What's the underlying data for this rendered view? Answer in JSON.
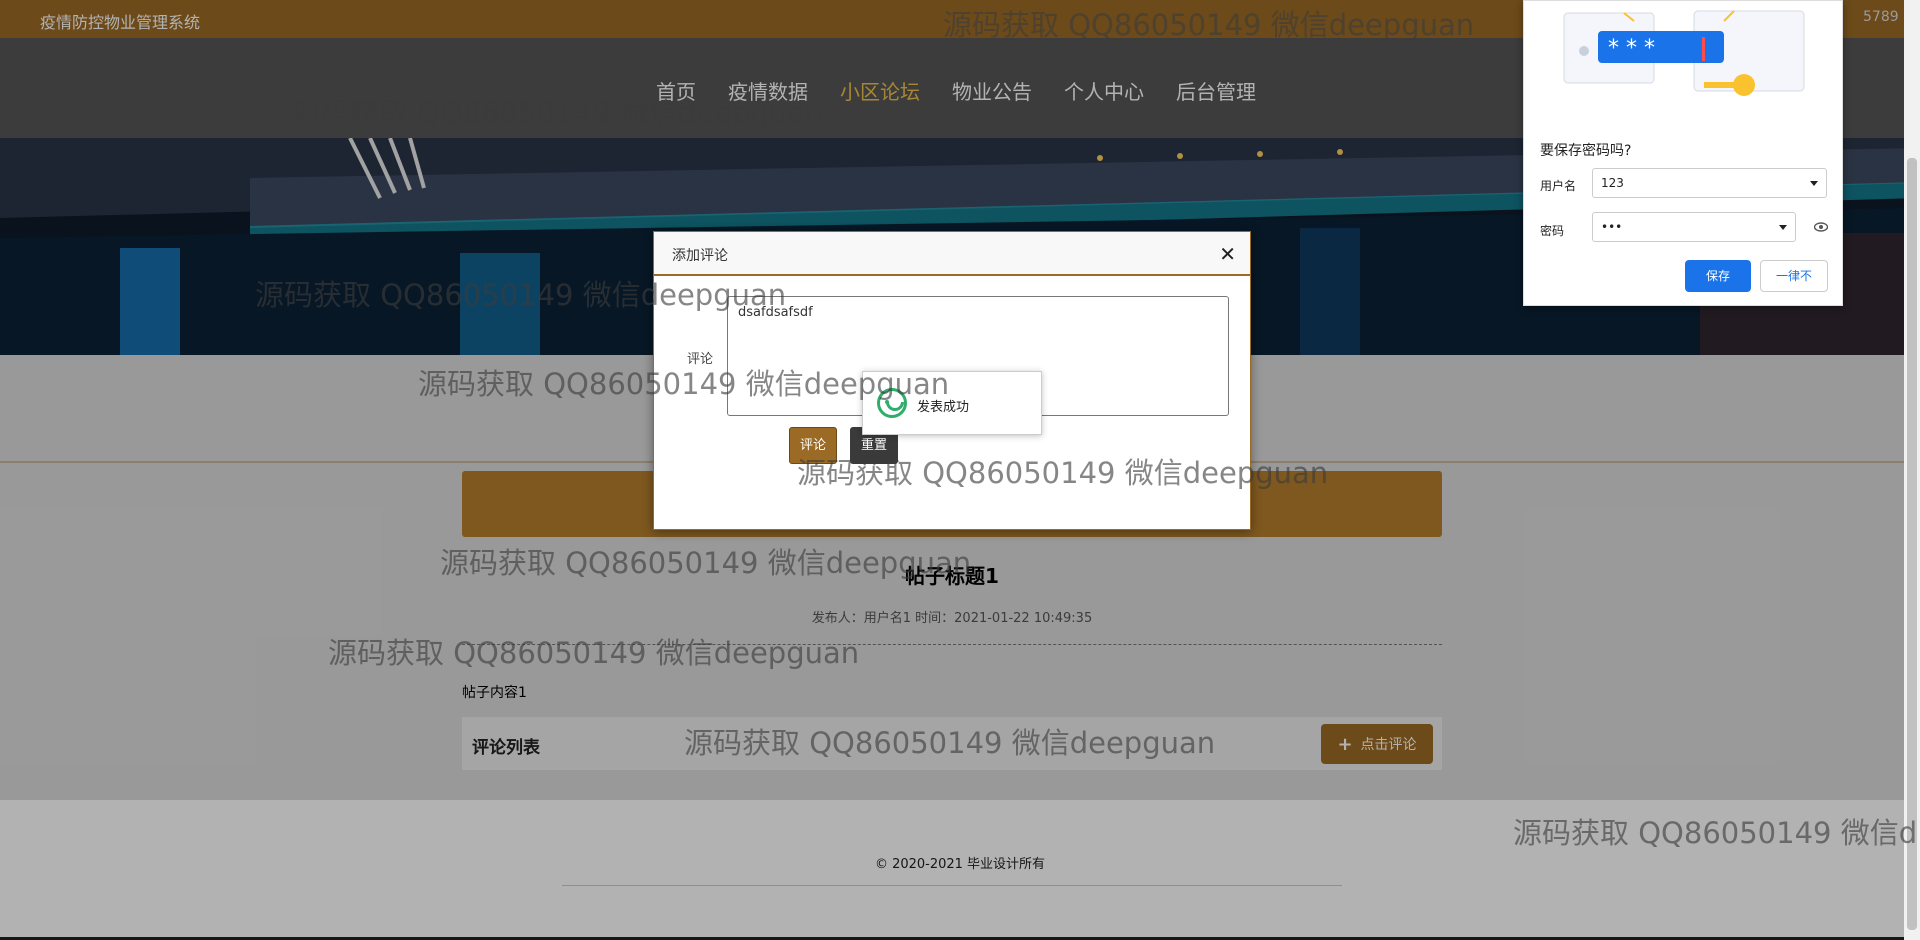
{
  "header": {
    "system_title": "疫情防控物业管理系统",
    "top_right_text": "5789"
  },
  "nav": {
    "items": [
      "首页",
      "疫情数据",
      "小区论坛",
      "物业公告",
      "个人中心",
      "后台管理"
    ],
    "active_index": 2
  },
  "post": {
    "title": "帖子标题1",
    "meta": "发布人：用户名1 时间：2021-01-22 10:49:35",
    "content": "帖子内容1"
  },
  "comments": {
    "list_label": "评论列表",
    "add_button": "点击评论"
  },
  "footer": {
    "copyright": "© 2020-2021 毕业设计所有"
  },
  "modal": {
    "title": "添加评论",
    "comment_label": "评论",
    "comment_value": "dsafdsafsdf",
    "submit_label": "评论",
    "reset_label": "重置"
  },
  "toast": {
    "message": "发表成功"
  },
  "password_prompt": {
    "title": "要保存密码吗?",
    "username_label": "用户名",
    "username_value": "123",
    "password_label": "密码",
    "password_value": "•••",
    "save_label": "保存",
    "never_label": "一律不",
    "stars": "* * *"
  },
  "watermark": {
    "text": "源码获取 QQ86050149 微信deepguan",
    "partial_1": "源码获取 QQ86050149 微信deepguan",
    "partial_2": "源码获取 QQ86050149 微信d"
  },
  "colors": {
    "brand": "#9b6a24",
    "active_nav": "#f0c24e",
    "chrome_blue": "#1a73e8",
    "success": "#2fae6b"
  }
}
